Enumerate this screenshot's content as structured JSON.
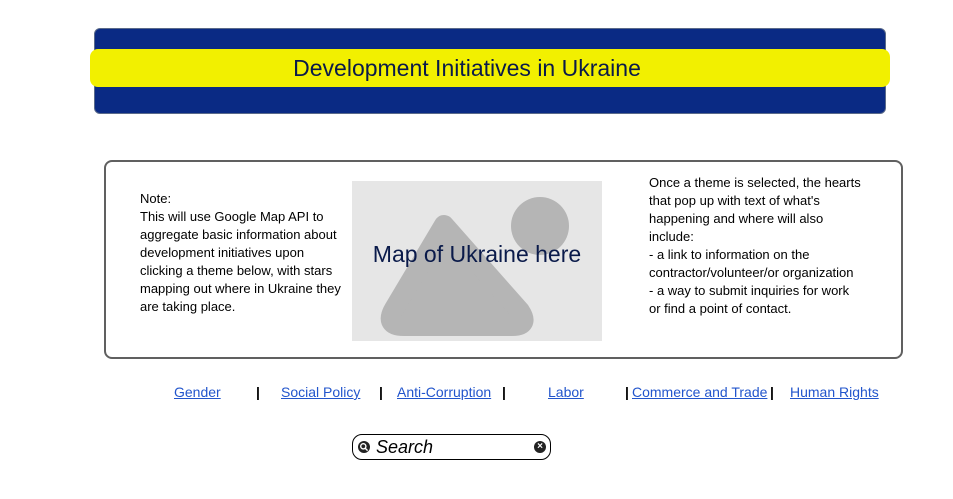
{
  "header": {
    "title": "Development Initiatives in Ukraine"
  },
  "note": {
    "heading": "Note:",
    "body": "This will use Google Map API to aggregate basic information about development initiatives upon clicking a theme below, with stars mapping out where in Ukraine they are taking place."
  },
  "map": {
    "label": "Map of Ukraine here"
  },
  "info": {
    "intro": "Once a theme is selected, the hearts that pop up with text of what's happening and where will also include:",
    "item1": "- a link to information on the contractor/volunteer/or organization",
    "item2": "- a way to submit inquiries for work or find a point of contact."
  },
  "nav": {
    "gender": "Gender",
    "social_policy": "Social Policy",
    "anti_corruption": "Anti-Corruption",
    "labor": "Labor",
    "commerce": "Commerce and Trade",
    "human_rights": "Human Rights",
    "separator": "|"
  },
  "search": {
    "label": "Search",
    "clear_glyph": "×"
  },
  "colors": {
    "banner_blue": "#0a2a84",
    "banner_yellow": "#f2f000",
    "link": "#2255cc"
  }
}
